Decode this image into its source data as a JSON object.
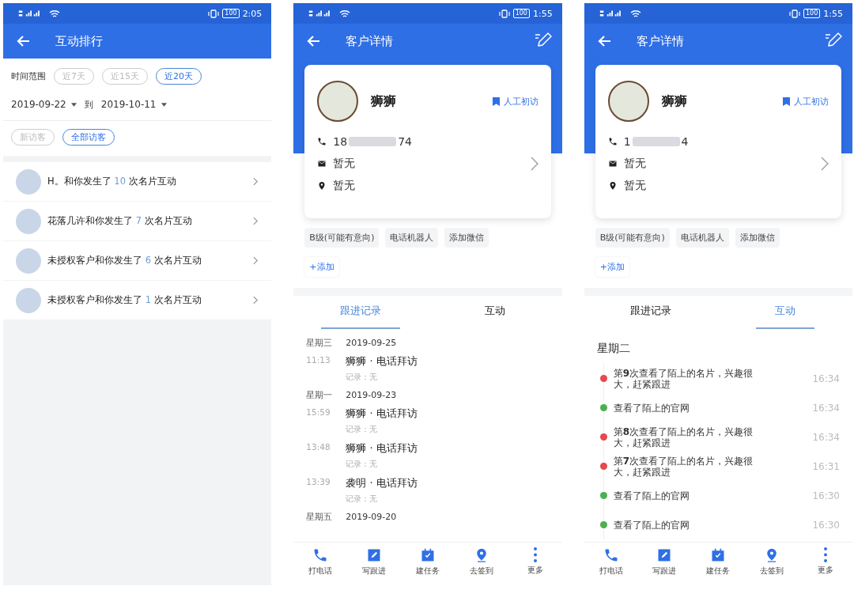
{
  "ranking": {
    "status_bar": {
      "battery": "100",
      "time": "2:05"
    },
    "title": "互动排行",
    "range_label": "时间范围",
    "range_options": [
      {
        "label": "近7天",
        "selected": false
      },
      {
        "label": "近15天",
        "selected": false
      },
      {
        "label": "近20天",
        "selected": true
      }
    ],
    "start_date": "2019-09-22",
    "to_label": "到",
    "end_date": "2019-10-11",
    "visitor_filters": [
      {
        "label": "新访客",
        "selected": false
      },
      {
        "label": "全部访客",
        "selected": true
      }
    ],
    "rows": [
      {
        "lead": "H。和你发生了",
        "count": "10",
        "tail": "次名片互动"
      },
      {
        "lead": "花落几许和你发生了",
        "count": "7",
        "tail": "次名片互动"
      },
      {
        "lead": "未授权客户和你发生了",
        "count": "6",
        "tail": "次名片互动"
      },
      {
        "lead": "未授权客户和你发生了",
        "count": "1",
        "tail": "次名片互动"
      }
    ]
  },
  "detail_screens": [
    {
      "status_bar": {
        "battery": "100",
        "time": "1:55"
      },
      "title": "客户详情",
      "name": "狮狮",
      "tag": "人工初访",
      "phone_start": "18",
      "phone_end": "74",
      "email": "暂无",
      "address": "暂无",
      "labels": [
        "B级(可能有意向)",
        "电话机器人",
        "添加微信"
      ],
      "add_label": "+添加",
      "tabs": [
        {
          "label": "跟进记录",
          "selected": true
        },
        {
          "label": "互动",
          "selected": false
        }
      ],
      "follow_ups": [
        {
          "weekday": "星期三",
          "date": "2019-09-25",
          "entries": [
            {
              "time": "11:13",
              "title": "狮狮 · 电话拜访",
              "note": "记录：无"
            }
          ]
        },
        {
          "weekday": "星期一",
          "date": "2019-09-23",
          "entries": [
            {
              "time": "15:59",
              "title": "狮狮 · 电话拜访",
              "note": "记录：无"
            },
            {
              "time": "13:48",
              "title": "狮狮 · 电话拜访",
              "note": "记录：无"
            },
            {
              "time": "13:39",
              "title": "袭明 · 电话拜访",
              "note": "记录：无"
            }
          ]
        },
        {
          "weekday": "星期五",
          "date": "2019-09-20"
        }
      ],
      "nav": [
        {
          "label": "打电话",
          "kind": "phone"
        },
        {
          "label": "写跟进",
          "kind": "edit"
        },
        {
          "label": "建任务",
          "kind": "task"
        },
        {
          "label": "去签到",
          "kind": "location"
        },
        {
          "label": "更多",
          "kind": "more"
        }
      ]
    },
    {
      "status_bar": {
        "battery": "100",
        "time": "1:55"
      },
      "title": "客户详情",
      "name": "狮狮",
      "tag": "人工初访",
      "phone_start": "1",
      "phone_end": "4",
      "email": "暂无",
      "address": "暂无",
      "labels": [
        "B级(可能有意向)",
        "电话机器人",
        "添加微信"
      ],
      "add_label": "+添加",
      "tabs": [
        {
          "label": "跟进记录",
          "selected": false
        },
        {
          "label": "互动",
          "selected": true
        }
      ],
      "interactions": {
        "day": "星期二",
        "items": [
          {
            "text": "第**9**次查看了陌上的名片，兴趣很大，赶紧跟进",
            "time": "16:34",
            "color": "#e5484d"
          },
          {
            "text": "查看了陌上的官网",
            "time": "16:34",
            "color": "#4caf50"
          },
          {
            "text": "第**8**次查看了陌上的名片，兴趣很大，赶紧跟进",
            "time": "16:34",
            "color": "#e5484d"
          },
          {
            "text": "第**7**次查看了陌上的名片，兴趣很大，赶紧跟进",
            "time": "16:31",
            "color": "#e5484d"
          },
          {
            "text": "查看了陌上的官网",
            "time": "16:30",
            "color": "#4caf50"
          },
          {
            "text": "查看了陌上的官网",
            "time": "16:30",
            "color": "#4caf50"
          }
        ]
      },
      "nav": [
        {
          "label": "打电话",
          "kind": "phone"
        },
        {
          "label": "写跟进",
          "kind": "edit"
        },
        {
          "label": "建任务",
          "kind": "task"
        },
        {
          "label": "去签到",
          "kind": "location"
        },
        {
          "label": "更多",
          "kind": "more"
        }
      ]
    }
  ]
}
